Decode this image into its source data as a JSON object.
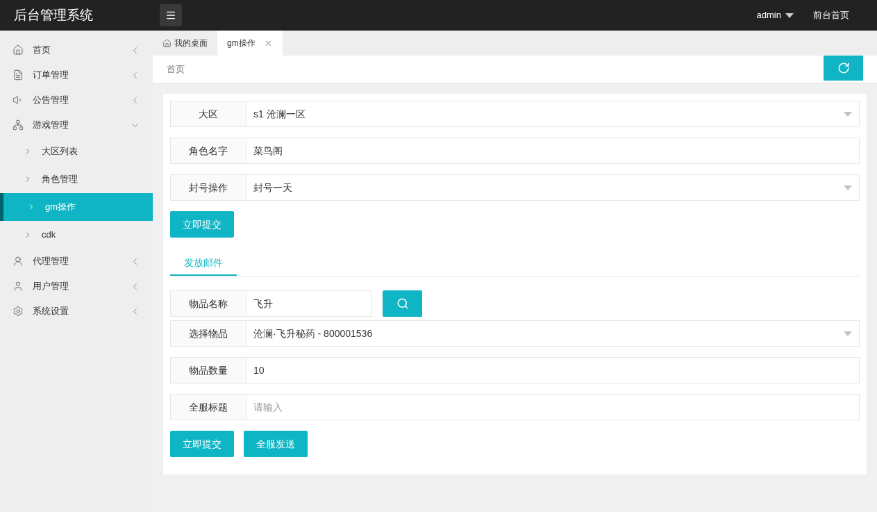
{
  "header": {
    "title": "后台管理系统",
    "user": "admin",
    "link": "前台首页"
  },
  "sidebar": {
    "items": [
      {
        "label": "首页",
        "expanded": false
      },
      {
        "label": "订单管理",
        "expanded": false
      },
      {
        "label": "公告管理",
        "expanded": false
      },
      {
        "label": "游戏管理",
        "expanded": true,
        "children": [
          {
            "label": "大区列表",
            "selected": false
          },
          {
            "label": "角色管理",
            "selected": false
          },
          {
            "label": "gm操作",
            "selected": true
          },
          {
            "label": "cdk",
            "selected": false
          }
        ]
      },
      {
        "label": "代理管理",
        "expanded": false
      },
      {
        "label": "用户管理",
        "expanded": false
      },
      {
        "label": "系统设置",
        "expanded": false
      }
    ]
  },
  "tabs": [
    {
      "label": "我的桌面",
      "selected": false,
      "closable": false
    },
    {
      "label": "gm操作",
      "selected": true,
      "closable": true
    }
  ],
  "breadcrumb": "首页",
  "form": {
    "rows": [
      {
        "kind": "select",
        "label": "大区",
        "value": "s1 沧澜一区"
      },
      {
        "kind": "text",
        "label": "角色名字",
        "value": "菜鸟阁"
      },
      {
        "kind": "select",
        "label": "封号操作",
        "value": "封号一天"
      }
    ],
    "buttons": [
      "立即提交"
    ]
  },
  "mail_tabs": [
    {
      "label": "发放邮件",
      "selected": true
    }
  ],
  "mail_form": {
    "rows": [
      {
        "kind": "search",
        "label": "物品名称",
        "value": "飞升"
      },
      {
        "kind": "select",
        "label": "选择物品",
        "value": "沧澜·飞升秘药 - 800001536"
      },
      {
        "kind": "text",
        "label": "物品数量",
        "value": "10"
      },
      {
        "kind": "text",
        "label": "全服标题",
        "placeholder": "请输入"
      }
    ],
    "buttons": [
      "立即提交",
      "全服发送"
    ]
  }
}
